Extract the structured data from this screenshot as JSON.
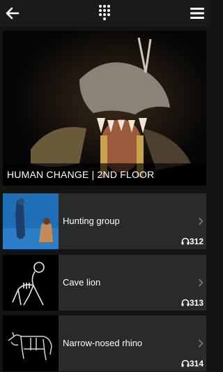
{
  "topbar": {
    "back_icon": "arrow-left-icon",
    "keypad_icon": "keypad-icon",
    "menu_icon": "hamburger-menu-icon"
  },
  "hero": {
    "caption": "HUMAN CHANGE | 2ND FLOOR"
  },
  "items": [
    {
      "title": "Hunting group",
      "number": "312",
      "icon": "headphones-icon"
    },
    {
      "title": "Cave lion",
      "number": "313",
      "icon": "headphones-icon"
    },
    {
      "title": "Narrow-nosed rhino",
      "number": "314",
      "icon": "headphones-icon"
    }
  ],
  "colors": {
    "background": "#141414",
    "card": "#2a2a2a",
    "chevron": "#7a7a7a"
  }
}
